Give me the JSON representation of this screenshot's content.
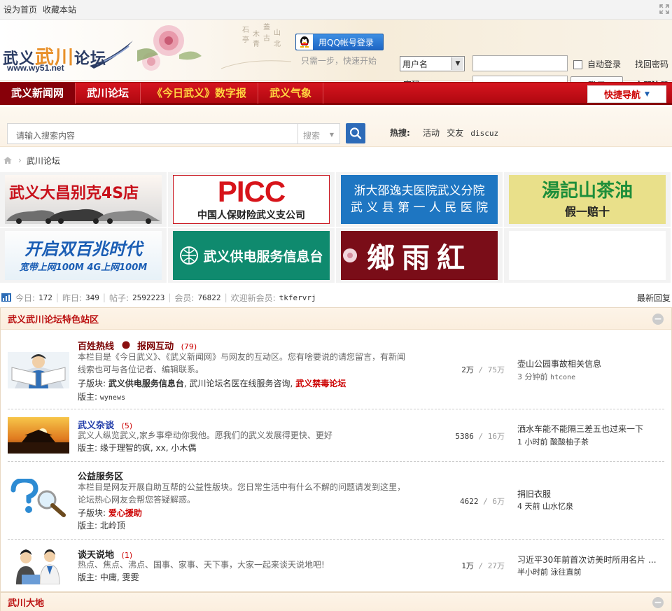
{
  "topbar": {
    "set_home": "设为首页",
    "bookmark": "收藏本站"
  },
  "logo": {
    "text_a": "武义",
    "text_b": "武川",
    "text_c": "论坛",
    "url": "www.wy51.net"
  },
  "qq": {
    "button": "用QQ帐号登录",
    "sub": "只需一步，快速开始"
  },
  "login": {
    "select_value": "用户名",
    "password_label": "密码",
    "auto_login": "自动登录",
    "find_password": "找回密码",
    "login_button": "登录",
    "register": "立即注册"
  },
  "nav": {
    "items": [
      "武义新闻网",
      "武川论坛",
      "《今日武义》数字报",
      "武义气象"
    ],
    "quick": "快捷导航"
  },
  "search": {
    "placeholder": "请输入搜索内容",
    "type": "搜索",
    "hot_label": "热搜:",
    "hot_terms": [
      "活动",
      "交友",
      "discuz"
    ]
  },
  "breadcrumb": {
    "current": "武川论坛"
  },
  "ads": [
    {
      "text": "武义大昌别克4S店"
    },
    {
      "text_a": "PICC",
      "text_b": "中国人保财险武义支公司"
    },
    {
      "text_a": "浙大邵逸夫医院武义分院",
      "text_b": "武 义 县 第 一 人 民 医 院"
    },
    {
      "text_a": "湯記山茶油",
      "text_b": "假一赔十"
    },
    {
      "text_a": "开启双百兆时代",
      "text_b": "宽带上网100M  4G上网100M"
    },
    {
      "text": "武义供电服务信息台"
    },
    {
      "text": "鄉雨紅"
    }
  ],
  "stats": {
    "today_label": "今日:",
    "today": "172",
    "yesterday_label": "昨日:",
    "yesterday": "349",
    "posts_label": "帖子:",
    "posts": "2592223",
    "members_label": "会员:",
    "members": "76822",
    "welcome_label": "欢迎新会员:",
    "newest_member": "tkfervrj",
    "latest_reply": "最新回复"
  },
  "section1": {
    "title": "武义武川论坛特色站区",
    "forums": [
      {
        "title_a": "百姓热线",
        "title_b": "报网互动",
        "count": "(79)",
        "desc": "本栏目是《今日武义》、《武义新闻网》与网友的互动区。您有啥要说的请您留言，有新闻线索也可与各位记者、编辑联系。",
        "sub_label": "子版块:",
        "sub_a": "武义供电服务信息台",
        "sub_b": "武川论坛名医在线服务咨询",
        "sub_c": "武义禁毒论坛",
        "mod_label": "版主:",
        "mod": "wynews",
        "threads": "2万",
        "posts": "75万",
        "last_title": "壶山公园事故相关信息",
        "last_time": "3 分钟前",
        "last_user": "htcone"
      },
      {
        "title": "武义杂谈",
        "count": "(5)",
        "desc": "武义人纵览武义,家乡事牵动你我他。愿我们的武义发展得更快、更好",
        "mod_label": "版主:",
        "mod": "缘于理智的疯, xx, 小木偶",
        "threads": "5386",
        "posts": "16万",
        "last_title": "洒水车能不能隔三差五也过来一下",
        "last_time": "1 小时前",
        "last_user": "酸酸柚子茶"
      },
      {
        "title": "公益服务区",
        "desc": "本栏目是网友开展自助互帮的公益性版块。您日常生活中有什么不解的问题请发到这里，论坛热心网友会帮您答疑解惑。",
        "sub_label": "子版块:",
        "sub_a": "爱心援助",
        "mod_label": "版主:",
        "mod": "北岭顶",
        "threads": "4622",
        "posts": "6万",
        "last_title": "捐旧衣服",
        "last_time": "4 天前",
        "last_user": "山水忆泉"
      },
      {
        "title": "谈天说地",
        "count": "(1)",
        "desc": "热点、焦点、沸点、国事、家事、天下事，大家一起来谈天说地吧!",
        "mod_label": "版主:",
        "mod": "中庸, 雯雯",
        "threads": "1万",
        "posts": "27万",
        "last_title": "习近平30年前首次访美时所用名片 ...",
        "last_time": "半小时前",
        "last_user": "泳往直前"
      }
    ]
  },
  "section2": {
    "title": "武川大地"
  },
  "icons": {
    "qq": "qq-penguin-icon",
    "search": "magnifier-icon",
    "home": "home-icon",
    "stats": "bar-chart-icon",
    "toggle": "collapse-icon",
    "expand": "fullscreen-icon"
  },
  "colors": {
    "nav_red": "#c8101a",
    "accent_red": "#cc0000",
    "link_blue": "#1e3aa8",
    "qq_blue": "#2a78d6"
  }
}
